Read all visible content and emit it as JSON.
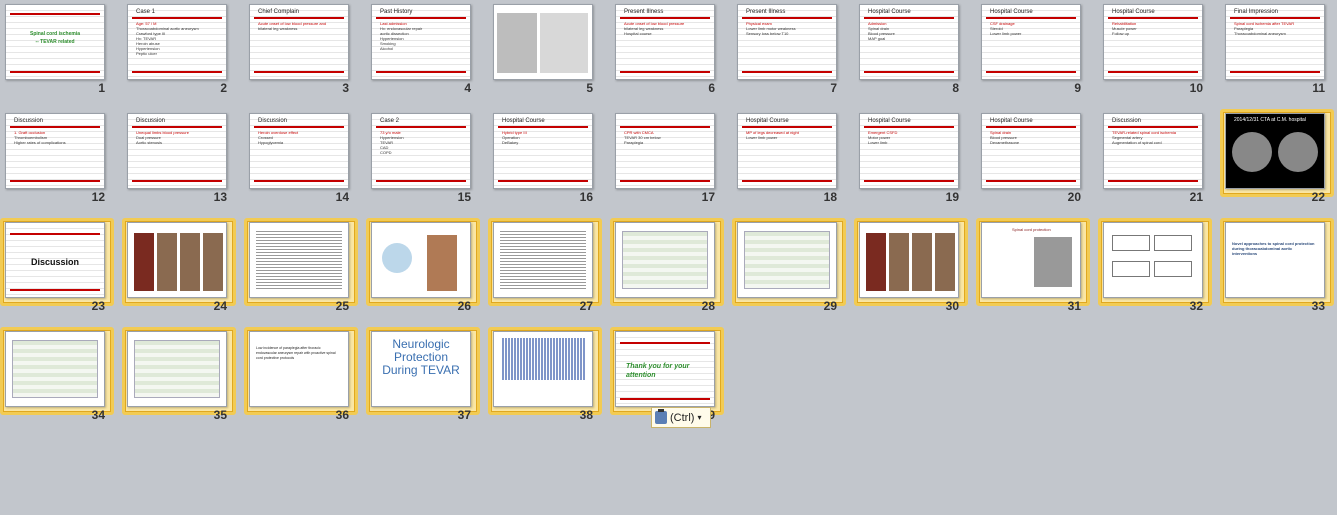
{
  "paste_options": {
    "label": "(Ctrl)",
    "icon": "clipboard-paste-icon",
    "arrow": "▾"
  },
  "slides": [
    {
      "num": "1",
      "title": "",
      "lines": [
        "Spinal cord ischemia",
        "-- TEVAR related"
      ],
      "kind": "cover"
    },
    {
      "num": "2",
      "title": "Case 1",
      "lines": [
        "Age: 57 / M",
        "Thoracoabdominal aortic aneurysm",
        "Crawford type III",
        "Hx: TEVAR",
        "Heroin abuse",
        "Hypertension",
        "Peptic ulcer"
      ],
      "kind": "text"
    },
    {
      "num": "3",
      "title": "Chief Complain",
      "lines": [
        "Acute onset of low blood pressure and",
        "bilateral leg weakness"
      ],
      "kind": "text"
    },
    {
      "num": "4",
      "title": "Past History",
      "lines": [
        "Last admission",
        "Hx: endovascular repair",
        "aortic dissection",
        "Hypertension",
        "Smoking",
        "Alcohol"
      ],
      "kind": "text"
    },
    {
      "num": "5",
      "title": "",
      "lines": [],
      "kind": "images"
    },
    {
      "num": "6",
      "title": "Present Illness",
      "lines": [
        "Acute onset of low blood pressure",
        "bilateral leg weakness",
        "Hospital course"
      ],
      "kind": "text"
    },
    {
      "num": "7",
      "title": "Present Illness",
      "lines": [
        "Physical exam",
        "Lower limb motor weakness",
        "Sensory loss below T10"
      ],
      "kind": "text"
    },
    {
      "num": "8",
      "title": "Hospital Course",
      "lines": [
        "Admission",
        "Spinal drain",
        "Blood pressure",
        "MAP goal"
      ],
      "kind": "text"
    },
    {
      "num": "9",
      "title": "Hospital Course",
      "lines": [
        "CSF drainage",
        "Steroid",
        "Lower limb power"
      ],
      "kind": "text"
    },
    {
      "num": "10",
      "title": "Hospital Course",
      "lines": [
        "Rehabilitation",
        "Muscle power",
        "Follow up"
      ],
      "kind": "text"
    },
    {
      "num": "11",
      "title": "Final Impression",
      "lines": [
        "Spinal cord ischemia after TEVAR",
        "Paraplegia",
        "Thoracoabdominal aneurysm"
      ],
      "kind": "text"
    },
    {
      "num": "12",
      "title": "Discussion",
      "lines": [
        "1. Graft occlusion",
        "Thromboembolism",
        "Higher rates of complications"
      ],
      "kind": "text"
    },
    {
      "num": "13",
      "title": "Discussion",
      "lines": [
        "Unequal limbs blood pressure",
        "Dual pressure",
        "Aortic stenosis"
      ],
      "kind": "text"
    },
    {
      "num": "14",
      "title": "Discussion",
      "lines": [
        "Heroin overdose effect",
        "Crossed",
        "Hypoglycemia"
      ],
      "kind": "text"
    },
    {
      "num": "15",
      "title": "Case 2",
      "lines": [
        "73 y/o male",
        "Hypertension",
        "TEVAR",
        "CAD",
        "COPD"
      ],
      "kind": "text"
    },
    {
      "num": "16",
      "title": "Hospital Course",
      "lines": [
        "Hybrid type III",
        "Operation",
        "DeBakey"
      ],
      "kind": "text"
    },
    {
      "num": "17",
      "title": "",
      "lines": [
        "CPR with CMCA",
        "TEVAR 30 cm below",
        "Paraplegia"
      ],
      "kind": "text"
    },
    {
      "num": "18",
      "title": "Hospital Course",
      "lines": [
        "MP of legs decreased at night",
        "Lower limb power"
      ],
      "kind": "text"
    },
    {
      "num": "19",
      "title": "Hospital Course",
      "lines": [
        "Emergent CSFD",
        "Motor power",
        "Lower limb"
      ],
      "kind": "text"
    },
    {
      "num": "20",
      "title": "Hospital Course",
      "lines": [
        "Spinal drain",
        "Blood pressure",
        "Dexamethasone"
      ],
      "kind": "text"
    },
    {
      "num": "21",
      "title": "Discussion",
      "lines": [
        "TEVAR-related spinal cord ischemia",
        "Segmental artery",
        "Augmentation of spinal cord"
      ],
      "kind": "text"
    },
    {
      "num": "22",
      "title": "2014/12/31 CTA at C.M. hospital",
      "lines": [],
      "kind": "ct"
    },
    {
      "num": "23",
      "title": "",
      "lines": [
        "Discussion"
      ],
      "kind": "bigword"
    },
    {
      "num": "24",
      "title": "",
      "lines": [],
      "kind": "photos"
    },
    {
      "num": "25",
      "title": "",
      "lines": [],
      "kind": "dense"
    },
    {
      "num": "26",
      "title": "",
      "lines": [],
      "kind": "diagram"
    },
    {
      "num": "27",
      "title": "",
      "lines": [],
      "kind": "dense"
    },
    {
      "num": "28",
      "title": "",
      "lines": [],
      "kind": "table"
    },
    {
      "num": "29",
      "title": "",
      "lines": [],
      "kind": "table"
    },
    {
      "num": "30",
      "title": "",
      "lines": [],
      "kind": "photos"
    },
    {
      "num": "31",
      "title": "Spinal cord protection",
      "lines": [],
      "kind": "portrait"
    },
    {
      "num": "32",
      "title": "",
      "lines": [],
      "kind": "flow"
    },
    {
      "num": "33",
      "title": "Novel approaches to spinal cord protection during thoracoabdominal aortic interventions",
      "lines": [],
      "kind": "paper"
    },
    {
      "num": "34",
      "title": "",
      "lines": [],
      "kind": "table"
    },
    {
      "num": "35",
      "title": "",
      "lines": [],
      "kind": "table"
    },
    {
      "num": "36",
      "title": "",
      "lines": [
        "Low incidence of paraplegia after thoracic",
        "endovascular aneurysm repair with proactive spinal",
        "cord protective protocols"
      ],
      "kind": "paper"
    },
    {
      "num": "37",
      "title": "",
      "lines": [
        "Neurologic",
        "Protection",
        "During TEVAR"
      ],
      "kind": "neuro"
    },
    {
      "num": "38",
      "title": "",
      "lines": [],
      "kind": "chart"
    },
    {
      "num": "39",
      "title": "",
      "lines": [
        "Thank you for your",
        "attention"
      ],
      "kind": "thanks"
    }
  ]
}
